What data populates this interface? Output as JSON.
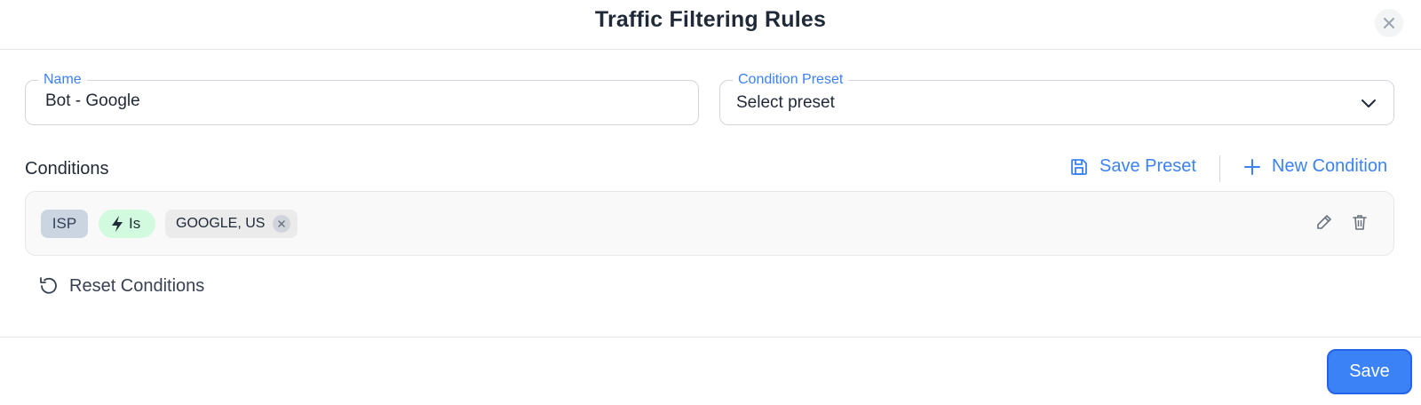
{
  "dialog": {
    "title": "Traffic Filtering Rules",
    "close_icon": "close-icon"
  },
  "form": {
    "name_label": "Name",
    "name_value": "Bot - Google",
    "preset_label": "Condition Preset",
    "preset_value": "Select preset"
  },
  "conditions": {
    "label": "Conditions",
    "save_preset_label": "Save Preset",
    "new_condition_label": "New Condition",
    "rows": [
      {
        "field": "ISP",
        "operator": "Is",
        "values": [
          "GOOGLE, US"
        ]
      }
    ],
    "reset_label": "Reset Conditions"
  },
  "footer": {
    "save_label": "Save"
  },
  "colors": {
    "accent": "#3b82f6",
    "operator_bg": "#d1fadf",
    "field_bg": "#cbd5e1"
  }
}
